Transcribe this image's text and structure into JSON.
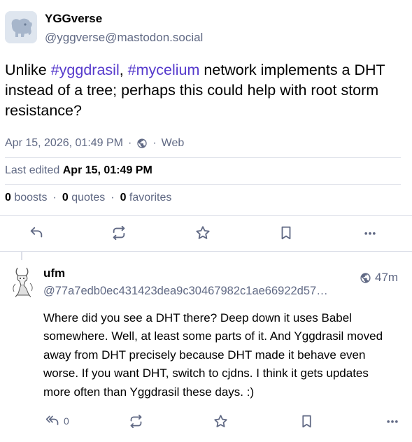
{
  "status": {
    "display_name": "YGGverse",
    "acct": "@yggverse@mastodon.social",
    "content": {
      "part1": "Unlike ",
      "hashtag1": "#yggdrasil",
      "part2": ", ",
      "hashtag2": "#mycelium",
      "part3": " network implements a DHT instead of a tree; perhaps this could help with root storm resistance?"
    },
    "timestamp": "Apr 15, 2026, 01:49 PM",
    "sep": "·",
    "visibility_icon": "globe-icon",
    "application": "Web",
    "edited_label": "Last edited",
    "edited_date": "Apr 15, 01:49 PM",
    "boosts_count": "0",
    "boosts_label": "boosts",
    "quotes_count": "0",
    "quotes_label": "quotes",
    "favorites_count": "0",
    "favorites_label": "favorites"
  },
  "reply": {
    "display_name": "ufm",
    "acct": "@77a7edb0ec431423dea9c30467982c1ae66922d57…",
    "time": "47m",
    "visibility_icon": "globe-icon",
    "content": "Where did you see a DHT there? Deep down it uses Babel somewhere. Well, at least some parts of it. And Yggdrasil moved away from DHT precisely because DHT made it behave even worse. If you want DHT, switch to cjdns. I think it gets updates more often than Yggdrasil these days. :)",
    "reply_count": "0"
  },
  "colors": {
    "accent": "#563acc",
    "muted": "#606984",
    "divider": "#dcdfe8"
  }
}
